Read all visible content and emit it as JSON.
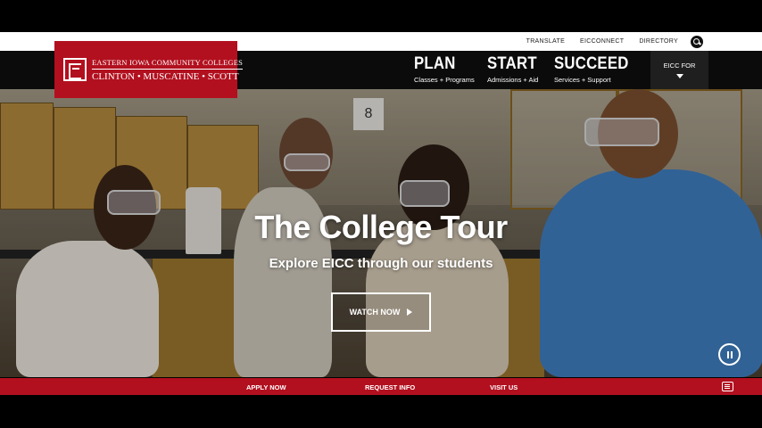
{
  "utility_nav": {
    "links": [
      "TRANSLATE",
      "EICCONNECT",
      "DIRECTORY"
    ],
    "search_icon": "search-icon"
  },
  "logo": {
    "line1": "EASTERN IOWA COMMUNITY COLLEGES",
    "line2": "CLINTON • MUSCATINE • SCOTT"
  },
  "main_nav": [
    {
      "label": "PLAN",
      "sub": "Classes + Programs"
    },
    {
      "label": "START",
      "sub": "Admissions + Aid"
    },
    {
      "label": "SUCCEED",
      "sub": "Services + Support"
    }
  ],
  "eicc_for": {
    "label": "EICC FOR",
    "icon": "chevron-down-icon"
  },
  "hero": {
    "title": "The College Tour",
    "subtitle": "Explore EICC through our students",
    "button": "WATCH NOW",
    "pause_icon": "pause-icon",
    "room_number": "8"
  },
  "bottom_bar": {
    "links": [
      "APPLY NOW",
      "REQUEST INFO",
      "VISIT US"
    ],
    "chat_icon": "chat-icon"
  },
  "colors": {
    "brand_red": "#b2101f",
    "nav_black": "#0b0b0b"
  }
}
